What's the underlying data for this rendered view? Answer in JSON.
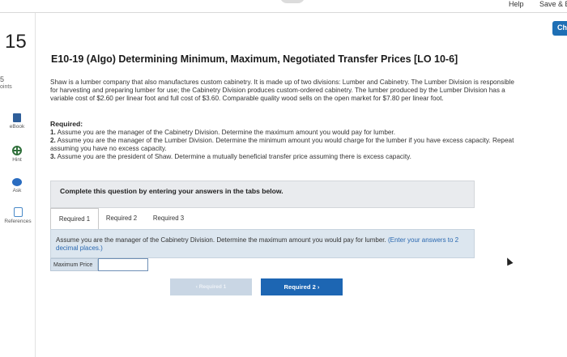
{
  "topbar": {
    "help": "Help",
    "save": "Save & E"
  },
  "check_button": "Ch",
  "sidebar": {
    "question_number": "15",
    "points_value": "5",
    "points_label": "oints",
    "ebook": "eBook",
    "hint": "Hint",
    "ask": "Ask",
    "references": "References"
  },
  "question": {
    "title": "E10-19 (Algo) Determining Minimum, Maximum, Negotiated Transfer Prices [LO 10-6]",
    "paragraph": "Shaw is a lumber company that also manufactures custom cabinetry. It is made up of two divisions: Lumber and Cabinetry. The Lumber Division is responsible for harvesting and preparing lumber for use; the Cabinetry Division produces custom-ordered cabinetry. The lumber produced by the Lumber Division has a variable cost of $2.60 per linear foot and full cost of $3.60. Comparable quality wood sells on the open market for $7.80 per linear foot.",
    "required_heading": "Required:",
    "requirements": [
      {
        "num": "1.",
        "text": "Assume you are the manager of the Cabinetry Division. Determine the maximum amount you would pay for lumber."
      },
      {
        "num": "2.",
        "text": "Assume you are the manager of the Lumber Division. Determine the minimum amount you would charge for the lumber if you have excess capacity. Repeat assuming you have no excess capacity."
      },
      {
        "num": "3.",
        "text": "Assume you are the president of Shaw. Determine a mutually beneficial transfer price assuming there is excess capacity."
      }
    ]
  },
  "instruction": "Complete this question by entering your answers in the tabs below.",
  "tabs": [
    {
      "label": "Required 1"
    },
    {
      "label": "Required 2"
    },
    {
      "label": "Required 3"
    }
  ],
  "prompt": {
    "text": "Assume you are the manager of the Cabinetry Division. Determine the maximum amount you would pay for lumber.",
    "hint": "(Enter your answers to 2 decimal places.)"
  },
  "answer": {
    "label": "Maximum Price",
    "value": ""
  },
  "nav": {
    "prev": "‹  Required 1",
    "next": "Required 2  ›"
  }
}
